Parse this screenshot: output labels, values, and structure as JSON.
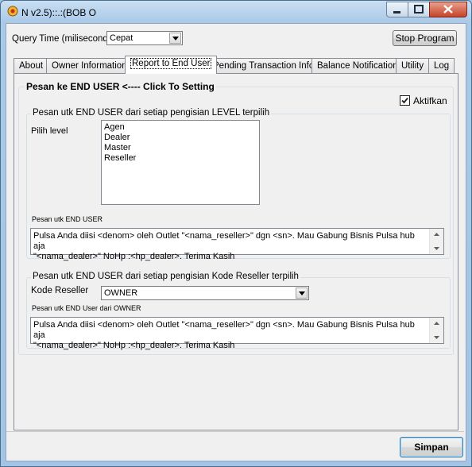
{
  "window": {
    "title": "N v2.5)::.:(BOB O"
  },
  "toolbar": {
    "query_time_label": "Query Time (milisecond)",
    "query_time_value": "Cepat",
    "stop_label": "Stop Program"
  },
  "tabs": [
    {
      "label": "About"
    },
    {
      "label": "Owner Information"
    },
    {
      "label": "Report to End User"
    },
    {
      "label": "Pending Transaction Info"
    },
    {
      "label": "Balance Notification"
    },
    {
      "label": "Utility"
    },
    {
      "label": "Log"
    }
  ],
  "panel": {
    "heading": "Pesan ke END USER <---- Click To Setting",
    "aktifkan_label": "Aktifkan",
    "aktifkan_checked": true
  },
  "group_level": {
    "title": "Pesan utk END USER dari setiap pengisian LEVEL terpilih",
    "pilih_label": "Pilih level",
    "levels": [
      "Agen",
      "Dealer",
      "Master",
      "Reseller"
    ],
    "message_label": "Pesan utk END USER",
    "message_line1": "Pulsa Anda diisi <denom> oleh Outlet \"<nama_reseller>\" dgn <sn>. Mau Gabung Bisnis Pulsa hub aja",
    "message_line2": "\"<nama_dealer>\"  NoHp :<hp_dealer>. Terima Kasih"
  },
  "group_reseller": {
    "title": "Pesan utk END USER dari setiap pengisian Kode Reseller terpilih",
    "kode_label": "Kode Reseller",
    "kode_value": "OWNER",
    "message_label": "Pesan utk END User dari OWNER",
    "message_line1": "Pulsa Anda diisi <denom> oleh Outlet \"<nama_reseller>\" dgn <sn>. Mau Gabung Bisnis Pulsa hub aja",
    "message_line2": "\"<nama_dealer>\"  NoHp :<hp_dealer>. Terima Kasih"
  },
  "footer": {
    "save_label": "Simpan"
  }
}
